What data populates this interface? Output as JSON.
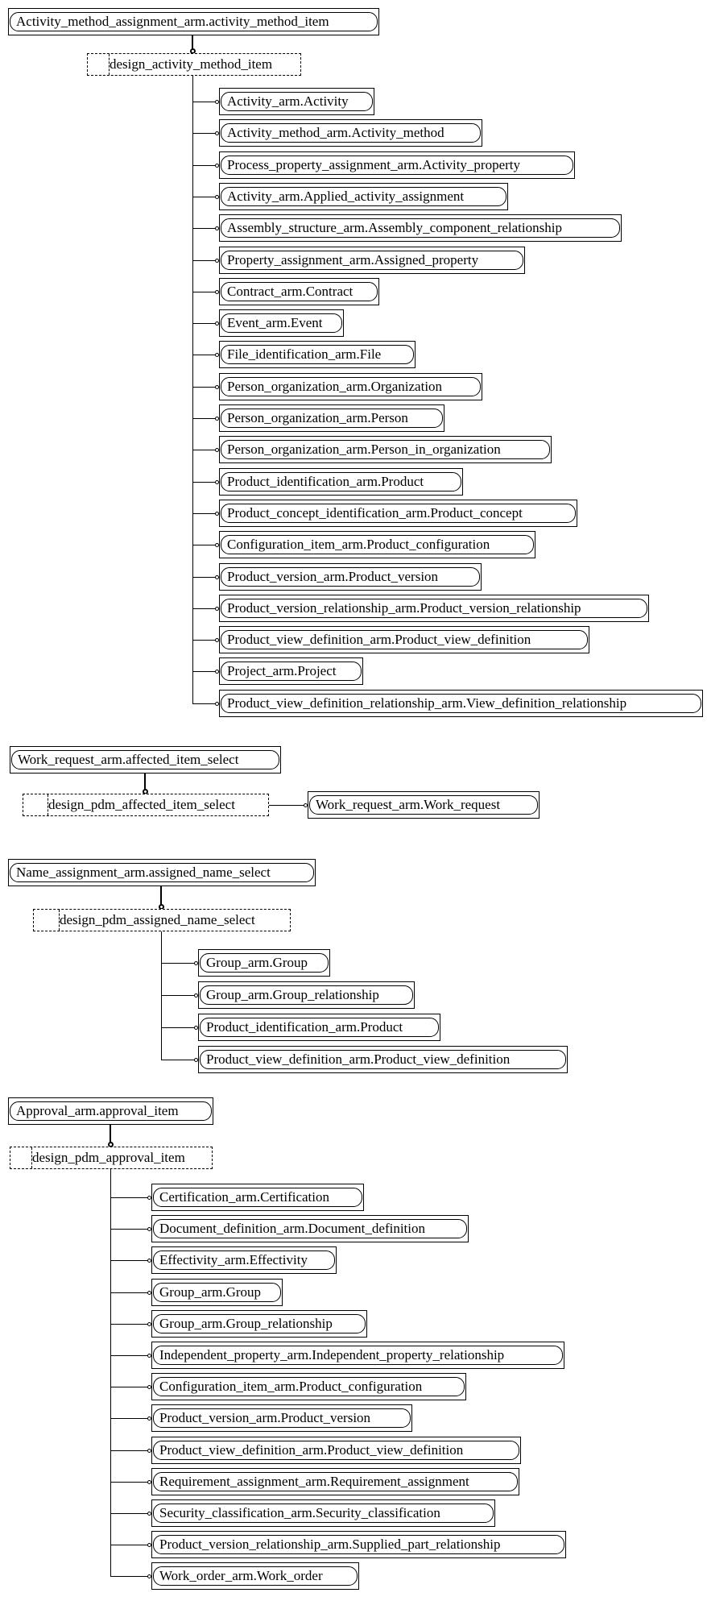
{
  "diagram": {
    "groups": [
      {
        "parent": "Activity_method_assignment_arm.activity_method_item",
        "select": "design_activity_method_item",
        "children": [
          "Activity_arm.Activity",
          "Activity_method_arm.Activity_method",
          "Process_property_assignment_arm.Activity_property",
          "Activity_arm.Applied_activity_assignment",
          "Assembly_structure_arm.Assembly_component_relationship",
          "Property_assignment_arm.Assigned_property",
          "Contract_arm.Contract",
          "Event_arm.Event",
          "File_identification_arm.File",
          "Person_organization_arm.Organization",
          "Person_organization_arm.Person",
          "Person_organization_arm.Person_in_organization",
          "Product_identification_arm.Product",
          "Product_concept_identification_arm.Product_concept",
          "Configuration_item_arm.Product_configuration",
          "Product_version_arm.Product_version",
          "Product_version_relationship_arm.Product_version_relationship",
          "Product_view_definition_arm.Product_view_definition",
          "Project_arm.Project",
          "Product_view_definition_relationship_arm.View_definition_relationship"
        ]
      },
      {
        "parent": "Work_request_arm.affected_item_select",
        "select": "design_pdm_affected_item_select",
        "children": [
          "Work_request_arm.Work_request"
        ]
      },
      {
        "parent": "Name_assignment_arm.assigned_name_select",
        "select": "design_pdm_assigned_name_select",
        "children": [
          "Group_arm.Group",
          "Group_arm.Group_relationship",
          "Product_identification_arm.Product",
          "Product_view_definition_arm.Product_view_definition"
        ]
      },
      {
        "parent": "Approval_arm.approval_item",
        "select": "design_pdm_approval_item",
        "children": [
          "Certification_arm.Certification",
          "Document_definition_arm.Document_definition",
          "Effectivity_arm.Effectivity",
          "Group_arm.Group",
          "Group_arm.Group_relationship",
          "Independent_property_arm.Independent_property_relationship",
          "Configuration_item_arm.Product_configuration",
          "Product_version_arm.Product_version",
          "Product_view_definition_arm.Product_view_definition",
          "Requirement_assignment_arm.Requirement_assignment",
          "Security_classification_arm.Security_classification",
          "Product_version_relationship_arm.Supplied_part_relationship",
          "Work_order_arm.Work_order"
        ]
      }
    ]
  }
}
